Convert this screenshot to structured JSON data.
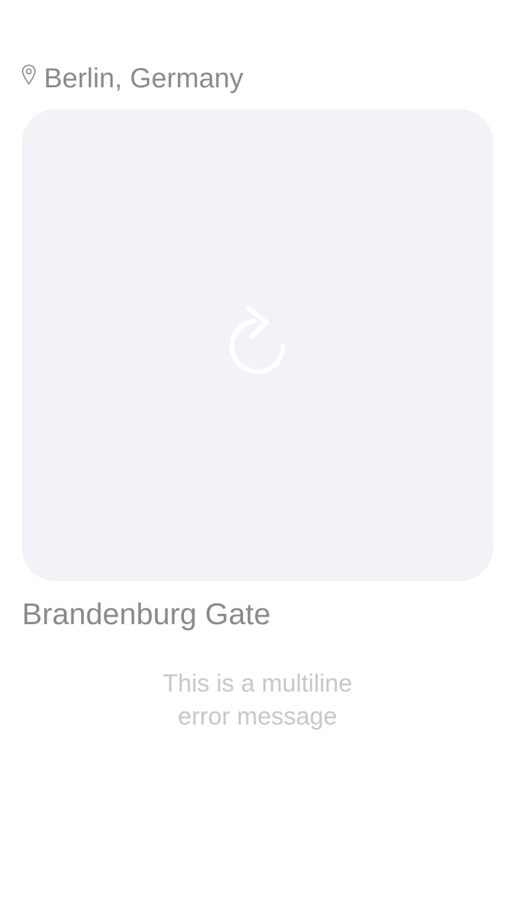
{
  "location": {
    "icon": "location-pin-icon",
    "label": "Berlin, Germany"
  },
  "image_card": {
    "state": "error",
    "retry_icon": "retry-icon",
    "background_color": "#f2f2f7",
    "icon_color": "#ffffff"
  },
  "place": {
    "title": "Brandenburg Gate"
  },
  "error": {
    "lines": [
      "This is a multiline",
      "error message"
    ]
  },
  "colors": {
    "primary_text": "#8a8a8e",
    "secondary_text": "#c7c7cc"
  }
}
